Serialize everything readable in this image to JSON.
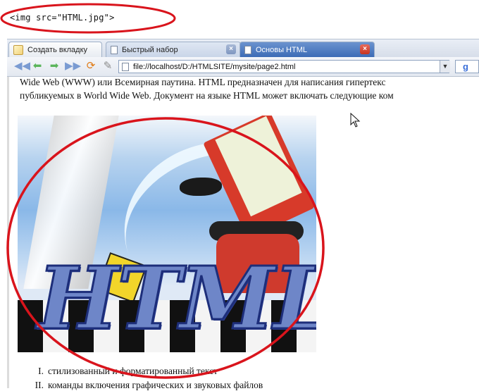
{
  "code_snippet": "<img src=\"HTML.jpg\">",
  "tabs": [
    {
      "label": "Создать вкладку"
    },
    {
      "label": "Быстрый набор"
    },
    {
      "label": "Основы HTML"
    }
  ],
  "address": {
    "url": "file://localhost/D:/HTMLSITE/mysite/page2.html"
  },
  "search_engine_icon": "google-g-icon",
  "content": {
    "line1": "Wide Web (WWW) или Всемирная паутина. HTML предназначен для написания гипертекс",
    "line2": "публикуемых в World Wide Web. Документ на языке HTML может включать следующие ком",
    "image_logo_text": "HTML",
    "list": [
      {
        "num": "I.",
        "text": "стилизованный и форматированный текст"
      },
      {
        "num": "II.",
        "text": "команды включения графических и звуковых файлов"
      }
    ]
  },
  "colors": {
    "annotation": "#d9141c",
    "active_tab": "#3c6bb6"
  }
}
